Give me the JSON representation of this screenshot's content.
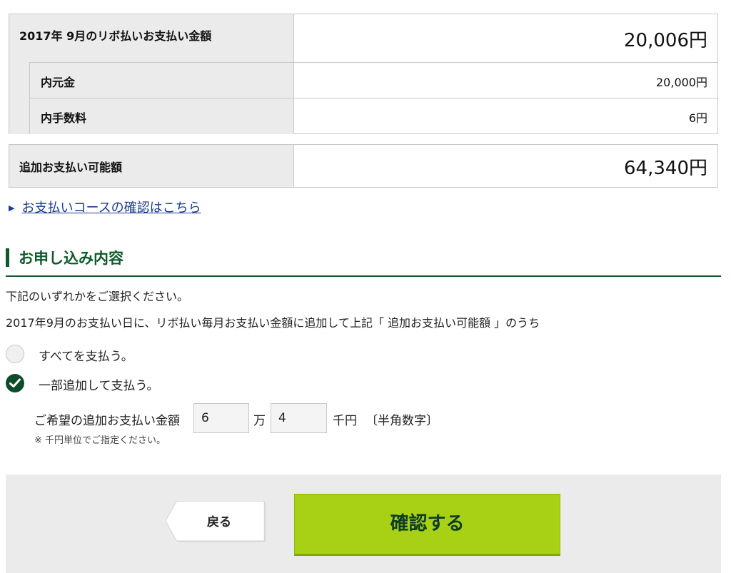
{
  "revo_table": {
    "title": "2017年 9月のリボ払いお支払い金額",
    "total": "20,006円",
    "rows": [
      {
        "label": "内元金",
        "value": "20,000円"
      },
      {
        "label": "内手数料",
        "value": "6円"
      }
    ]
  },
  "additional_table": {
    "label": "追加お支払い可能額",
    "value": "64,340円"
  },
  "course_link": {
    "label": "お支払いコースの確認はこちら"
  },
  "section": {
    "title": "お申し込み内容",
    "instruction": "下記のいずれかをご選択ください。",
    "description": "2017年9月のお支払い日に、リボ払い毎月お支払い金額に追加して上記「 追加お支払い可能額 」のうち"
  },
  "options": [
    {
      "label": "すべてを支払う。",
      "selected": false
    },
    {
      "label": "一部追加して支払う。",
      "selected": true
    }
  ],
  "amount": {
    "label": "ご希望の追加お支払い金額",
    "man_value": "6",
    "man_unit": "万",
    "sen_value": "4",
    "sen_unit": "千円",
    "hint": "〔半角数字〕",
    "note": "※ 千円単位でご指定ください。"
  },
  "buttons": {
    "back": "戻る",
    "confirm": "確認する"
  },
  "colors": {
    "accent_green": "#0e5a2a",
    "confirm_green": "#a8d014",
    "link_blue": "#1a3c8f"
  }
}
